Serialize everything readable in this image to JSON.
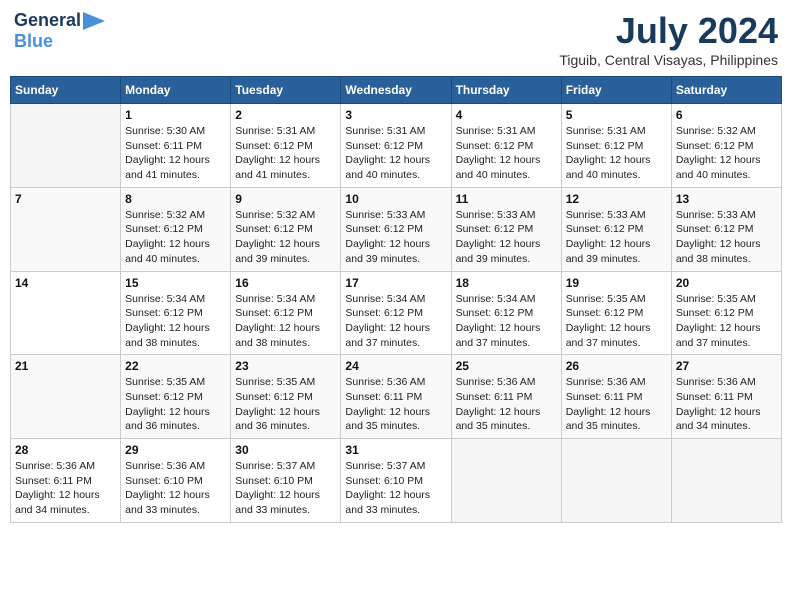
{
  "header": {
    "logo_general": "General",
    "logo_blue": "Blue",
    "title": "July 2024",
    "subtitle": "Tiguib, Central Visayas, Philippines"
  },
  "calendar": {
    "weekdays": [
      "Sunday",
      "Monday",
      "Tuesday",
      "Wednesday",
      "Thursday",
      "Friday",
      "Saturday"
    ],
    "weeks": [
      [
        {
          "day": "",
          "info": ""
        },
        {
          "day": "1",
          "info": "Sunrise: 5:30 AM\nSunset: 6:11 PM\nDaylight: 12 hours\nand 41 minutes."
        },
        {
          "day": "2",
          "info": "Sunrise: 5:31 AM\nSunset: 6:12 PM\nDaylight: 12 hours\nand 41 minutes."
        },
        {
          "day": "3",
          "info": "Sunrise: 5:31 AM\nSunset: 6:12 PM\nDaylight: 12 hours\nand 40 minutes."
        },
        {
          "day": "4",
          "info": "Sunrise: 5:31 AM\nSunset: 6:12 PM\nDaylight: 12 hours\nand 40 minutes."
        },
        {
          "day": "5",
          "info": "Sunrise: 5:31 AM\nSunset: 6:12 PM\nDaylight: 12 hours\nand 40 minutes."
        },
        {
          "day": "6",
          "info": "Sunrise: 5:32 AM\nSunset: 6:12 PM\nDaylight: 12 hours\nand 40 minutes."
        }
      ],
      [
        {
          "day": "7",
          "info": ""
        },
        {
          "day": "8",
          "info": "Sunrise: 5:32 AM\nSunset: 6:12 PM\nDaylight: 12 hours\nand 40 minutes."
        },
        {
          "day": "9",
          "info": "Sunrise: 5:32 AM\nSunset: 6:12 PM\nDaylight: 12 hours\nand 39 minutes."
        },
        {
          "day": "10",
          "info": "Sunrise: 5:33 AM\nSunset: 6:12 PM\nDaylight: 12 hours\nand 39 minutes."
        },
        {
          "day": "11",
          "info": "Sunrise: 5:33 AM\nSunset: 6:12 PM\nDaylight: 12 hours\nand 39 minutes."
        },
        {
          "day": "12",
          "info": "Sunrise: 5:33 AM\nSunset: 6:12 PM\nDaylight: 12 hours\nand 39 minutes."
        },
        {
          "day": "13",
          "info": "Sunrise: 5:33 AM\nSunset: 6:12 PM\nDaylight: 12 hours\nand 38 minutes."
        }
      ],
      [
        {
          "day": "14",
          "info": ""
        },
        {
          "day": "15",
          "info": "Sunrise: 5:34 AM\nSunset: 6:12 PM\nDaylight: 12 hours\nand 38 minutes."
        },
        {
          "day": "16",
          "info": "Sunrise: 5:34 AM\nSunset: 6:12 PM\nDaylight: 12 hours\nand 38 minutes."
        },
        {
          "day": "17",
          "info": "Sunrise: 5:34 AM\nSunset: 6:12 PM\nDaylight: 12 hours\nand 37 minutes."
        },
        {
          "day": "18",
          "info": "Sunrise: 5:34 AM\nSunset: 6:12 PM\nDaylight: 12 hours\nand 37 minutes."
        },
        {
          "day": "19",
          "info": "Sunrise: 5:35 AM\nSunset: 6:12 PM\nDaylight: 12 hours\nand 37 minutes."
        },
        {
          "day": "20",
          "info": "Sunrise: 5:35 AM\nSunset: 6:12 PM\nDaylight: 12 hours\nand 37 minutes."
        }
      ],
      [
        {
          "day": "21",
          "info": ""
        },
        {
          "day": "22",
          "info": "Sunrise: 5:35 AM\nSunset: 6:12 PM\nDaylight: 12 hours\nand 36 minutes."
        },
        {
          "day": "23",
          "info": "Sunrise: 5:35 AM\nSunset: 6:12 PM\nDaylight: 12 hours\nand 36 minutes."
        },
        {
          "day": "24",
          "info": "Sunrise: 5:36 AM\nSunset: 6:11 PM\nDaylight: 12 hours\nand 35 minutes."
        },
        {
          "day": "25",
          "info": "Sunrise: 5:36 AM\nSunset: 6:11 PM\nDaylight: 12 hours\nand 35 minutes."
        },
        {
          "day": "26",
          "info": "Sunrise: 5:36 AM\nSunset: 6:11 PM\nDaylight: 12 hours\nand 35 minutes."
        },
        {
          "day": "27",
          "info": "Sunrise: 5:36 AM\nSunset: 6:11 PM\nDaylight: 12 hours\nand 34 minutes."
        }
      ],
      [
        {
          "day": "28",
          "info": "Sunrise: 5:36 AM\nSunset: 6:11 PM\nDaylight: 12 hours\nand 34 minutes."
        },
        {
          "day": "29",
          "info": "Sunrise: 5:36 AM\nSunset: 6:10 PM\nDaylight: 12 hours\nand 33 minutes."
        },
        {
          "day": "30",
          "info": "Sunrise: 5:37 AM\nSunset: 6:10 PM\nDaylight: 12 hours\nand 33 minutes."
        },
        {
          "day": "31",
          "info": "Sunrise: 5:37 AM\nSunset: 6:10 PM\nDaylight: 12 hours\nand 33 minutes."
        },
        {
          "day": "",
          "info": ""
        },
        {
          "day": "",
          "info": ""
        },
        {
          "day": "",
          "info": ""
        }
      ]
    ]
  }
}
